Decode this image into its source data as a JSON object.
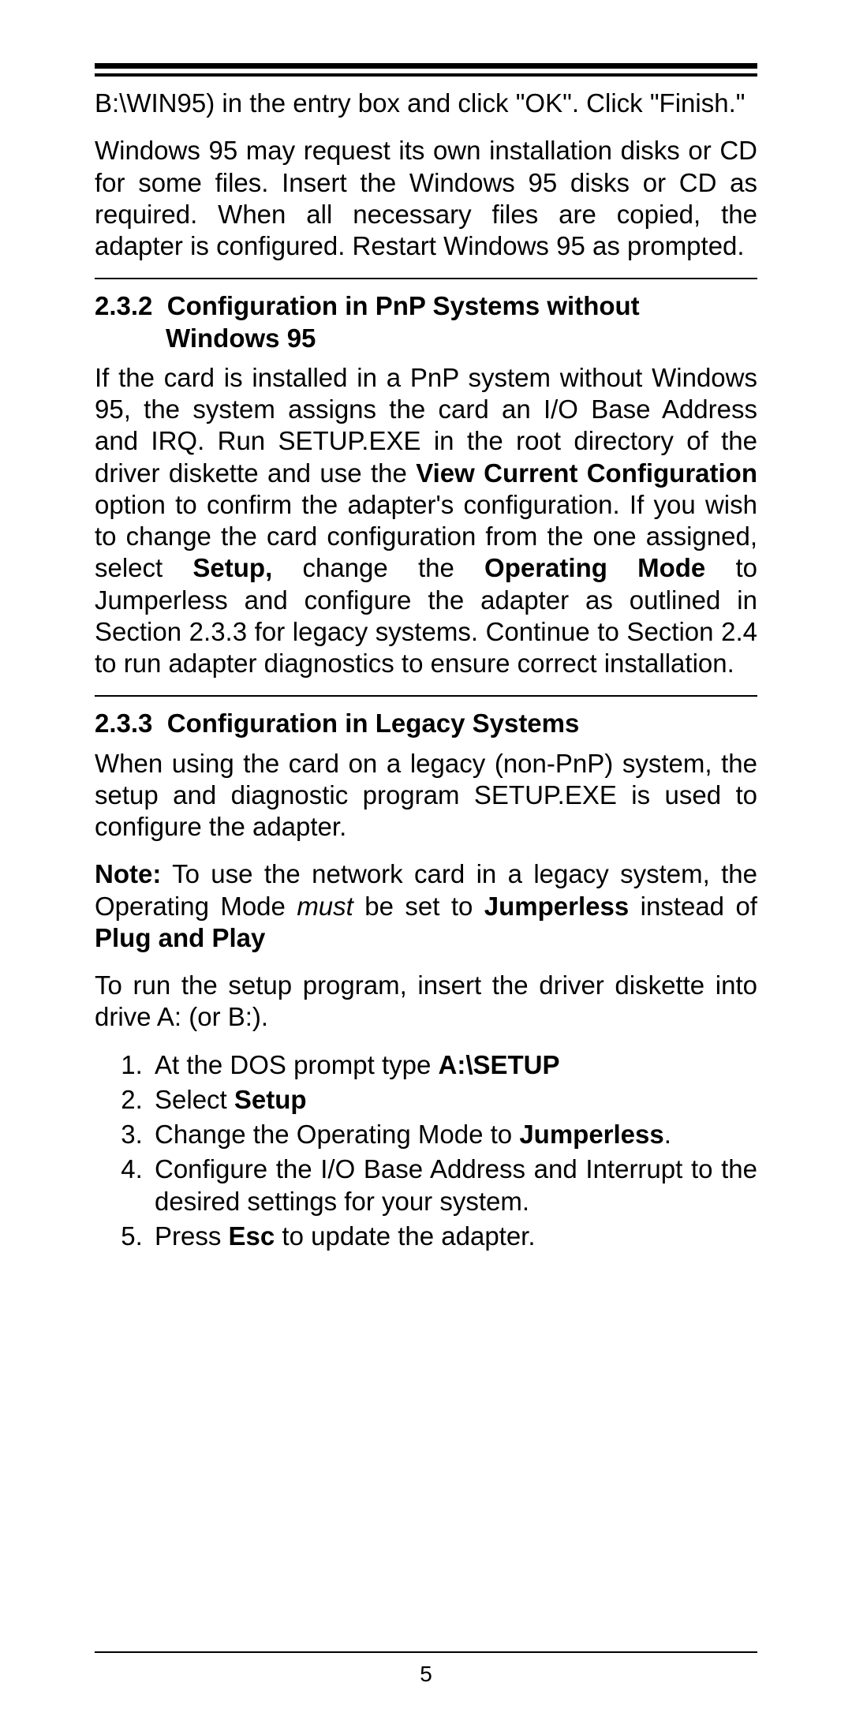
{
  "para1": "B:\\WIN95) in the entry box and click \"OK\". Click \"Finish.\"",
  "para2": "Windows 95 may request its own installation disks or CD for some files. Insert the Windows 95 disks or CD as required. When all necessary files are copied, the adapter is configured. Restart Windows 95 as prompted.",
  "sec232": {
    "num": "2.3.2",
    "title_l1": "Configuration in PnP Systems without",
    "title_l2": "Windows 95",
    "body_parts": {
      "p1": "If the card is installed in a PnP system without Windows 95, the system assigns the card an I/O Base Address and IRQ. Run SETUP.EXE in the root directory of the driver diskette and use the ",
      "b1": "View Current Configuration",
      "p2": " option to confirm the adapter's configuration. If you wish to change the card configuration from the one assigned, select ",
      "b2": "Setup,",
      "p3": " change the ",
      "b3": "Operating Mode",
      "p4": " to Jumperless and configure the adapter as outlined in Section 2.3.3 for legacy systems. Continue to Section 2.4 to run adapter diagnostics to ensure correct installation."
    }
  },
  "sec233": {
    "num": "2.3.3",
    "title": "Configuration in Legacy Systems",
    "para1": "When using the card on a legacy (non-PnP) system, the setup and diagnostic program SETUP.EXE is used to configure the adapter.",
    "note_parts": {
      "b1": "Note:",
      "t1": " To use the network card in a legacy system, the Operating Mode ",
      "i1": "must",
      "t2": " be set to ",
      "b2": "Jumperless",
      "t3": " instead of ",
      "b3": "Plug and Play"
    },
    "para_run": "To run the setup program, insert the driver diskette into drive A: (or B:).",
    "steps": {
      "s1a": "At the DOS prompt type ",
      "s1b": "A:\\SETUP",
      "s2a": "Select ",
      "s2b": "Setup",
      "s3a": "Change the Operating Mode to ",
      "s3b": "Jumperless",
      "s3c": ".",
      "s4": "Configure the I/O Base Address and Interrupt to the desired settings for your system.",
      "s5a": "Press ",
      "s5b": "Esc",
      "s5c": " to update the adapter."
    }
  },
  "page_number": "5"
}
